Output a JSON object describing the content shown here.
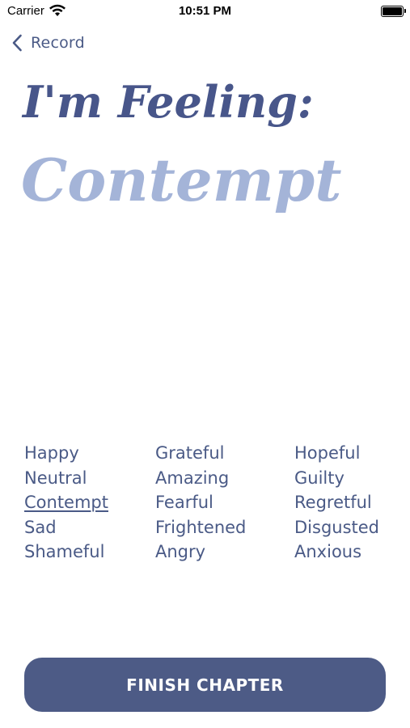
{
  "status_bar": {
    "carrier": "Carrier",
    "time": "10:51 PM"
  },
  "nav": {
    "back_label": "Record"
  },
  "header": {
    "prompt": "I'm Feeling:",
    "selected_emotion": "Contempt"
  },
  "emotions": {
    "column_1": [
      "Happy",
      "Neutral",
      "Contempt",
      "Sad",
      "Shameful"
    ],
    "column_2": [
      "Grateful",
      "Amazing",
      "Fearful",
      "Frightened",
      "Angry"
    ],
    "column_3": [
      "Hopeful",
      "Guilty",
      "Regretful",
      "Disgusted",
      "Anxious"
    ]
  },
  "actions": {
    "finish_label": "FINISH CHAPTER"
  },
  "colors": {
    "primary": "#4d5b86",
    "text": "#4a5a86",
    "emotion_accent": "#a4b4d8"
  }
}
